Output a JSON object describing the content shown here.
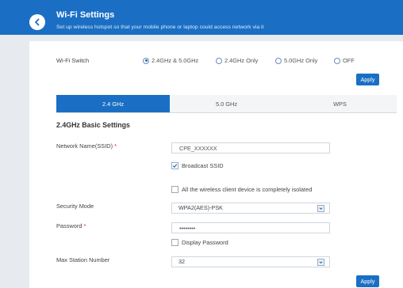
{
  "header": {
    "title": "Wi-Fi Settings",
    "subtitle": "Set up wireless hotspot so that your mobile phone or laptop could access network via it"
  },
  "wifi_switch": {
    "label": "Wi-Fi Switch",
    "options": [
      "2.4GHz & 5.0GHz",
      "2.4GHz Only",
      "5.0GHz Only",
      "OFF"
    ],
    "selected": "2.4GHz & 5.0GHz"
  },
  "apply_label": "Apply",
  "tabs": [
    {
      "label": "2.4 GHz",
      "active": true
    },
    {
      "label": "5.0 GHz",
      "active": false
    },
    {
      "label": "WPS",
      "active": false
    }
  ],
  "section_title": "2.4GHz Basic Settings",
  "ssid": {
    "label": "Network Name(SSID)",
    "required_mark": "*",
    "value": "CPE_XXXXXX"
  },
  "broadcast_ssid": {
    "label": "Broadcast SSID",
    "checked": true
  },
  "isolation": {
    "label": "All the wireless client device is completely isolated",
    "checked": false
  },
  "security_mode": {
    "label": "Security Mode",
    "value": "WPA2(AES)-PSK"
  },
  "password": {
    "label": "Password",
    "required_mark": "*",
    "value": "••••••••"
  },
  "display_password": {
    "label": "Display Password",
    "checked": false
  },
  "max_station": {
    "label": "Max Station Number",
    "value": "32"
  },
  "colors": {
    "accent": "#1a6fc4",
    "background": "#e7eaee",
    "required": "#d9241d"
  }
}
